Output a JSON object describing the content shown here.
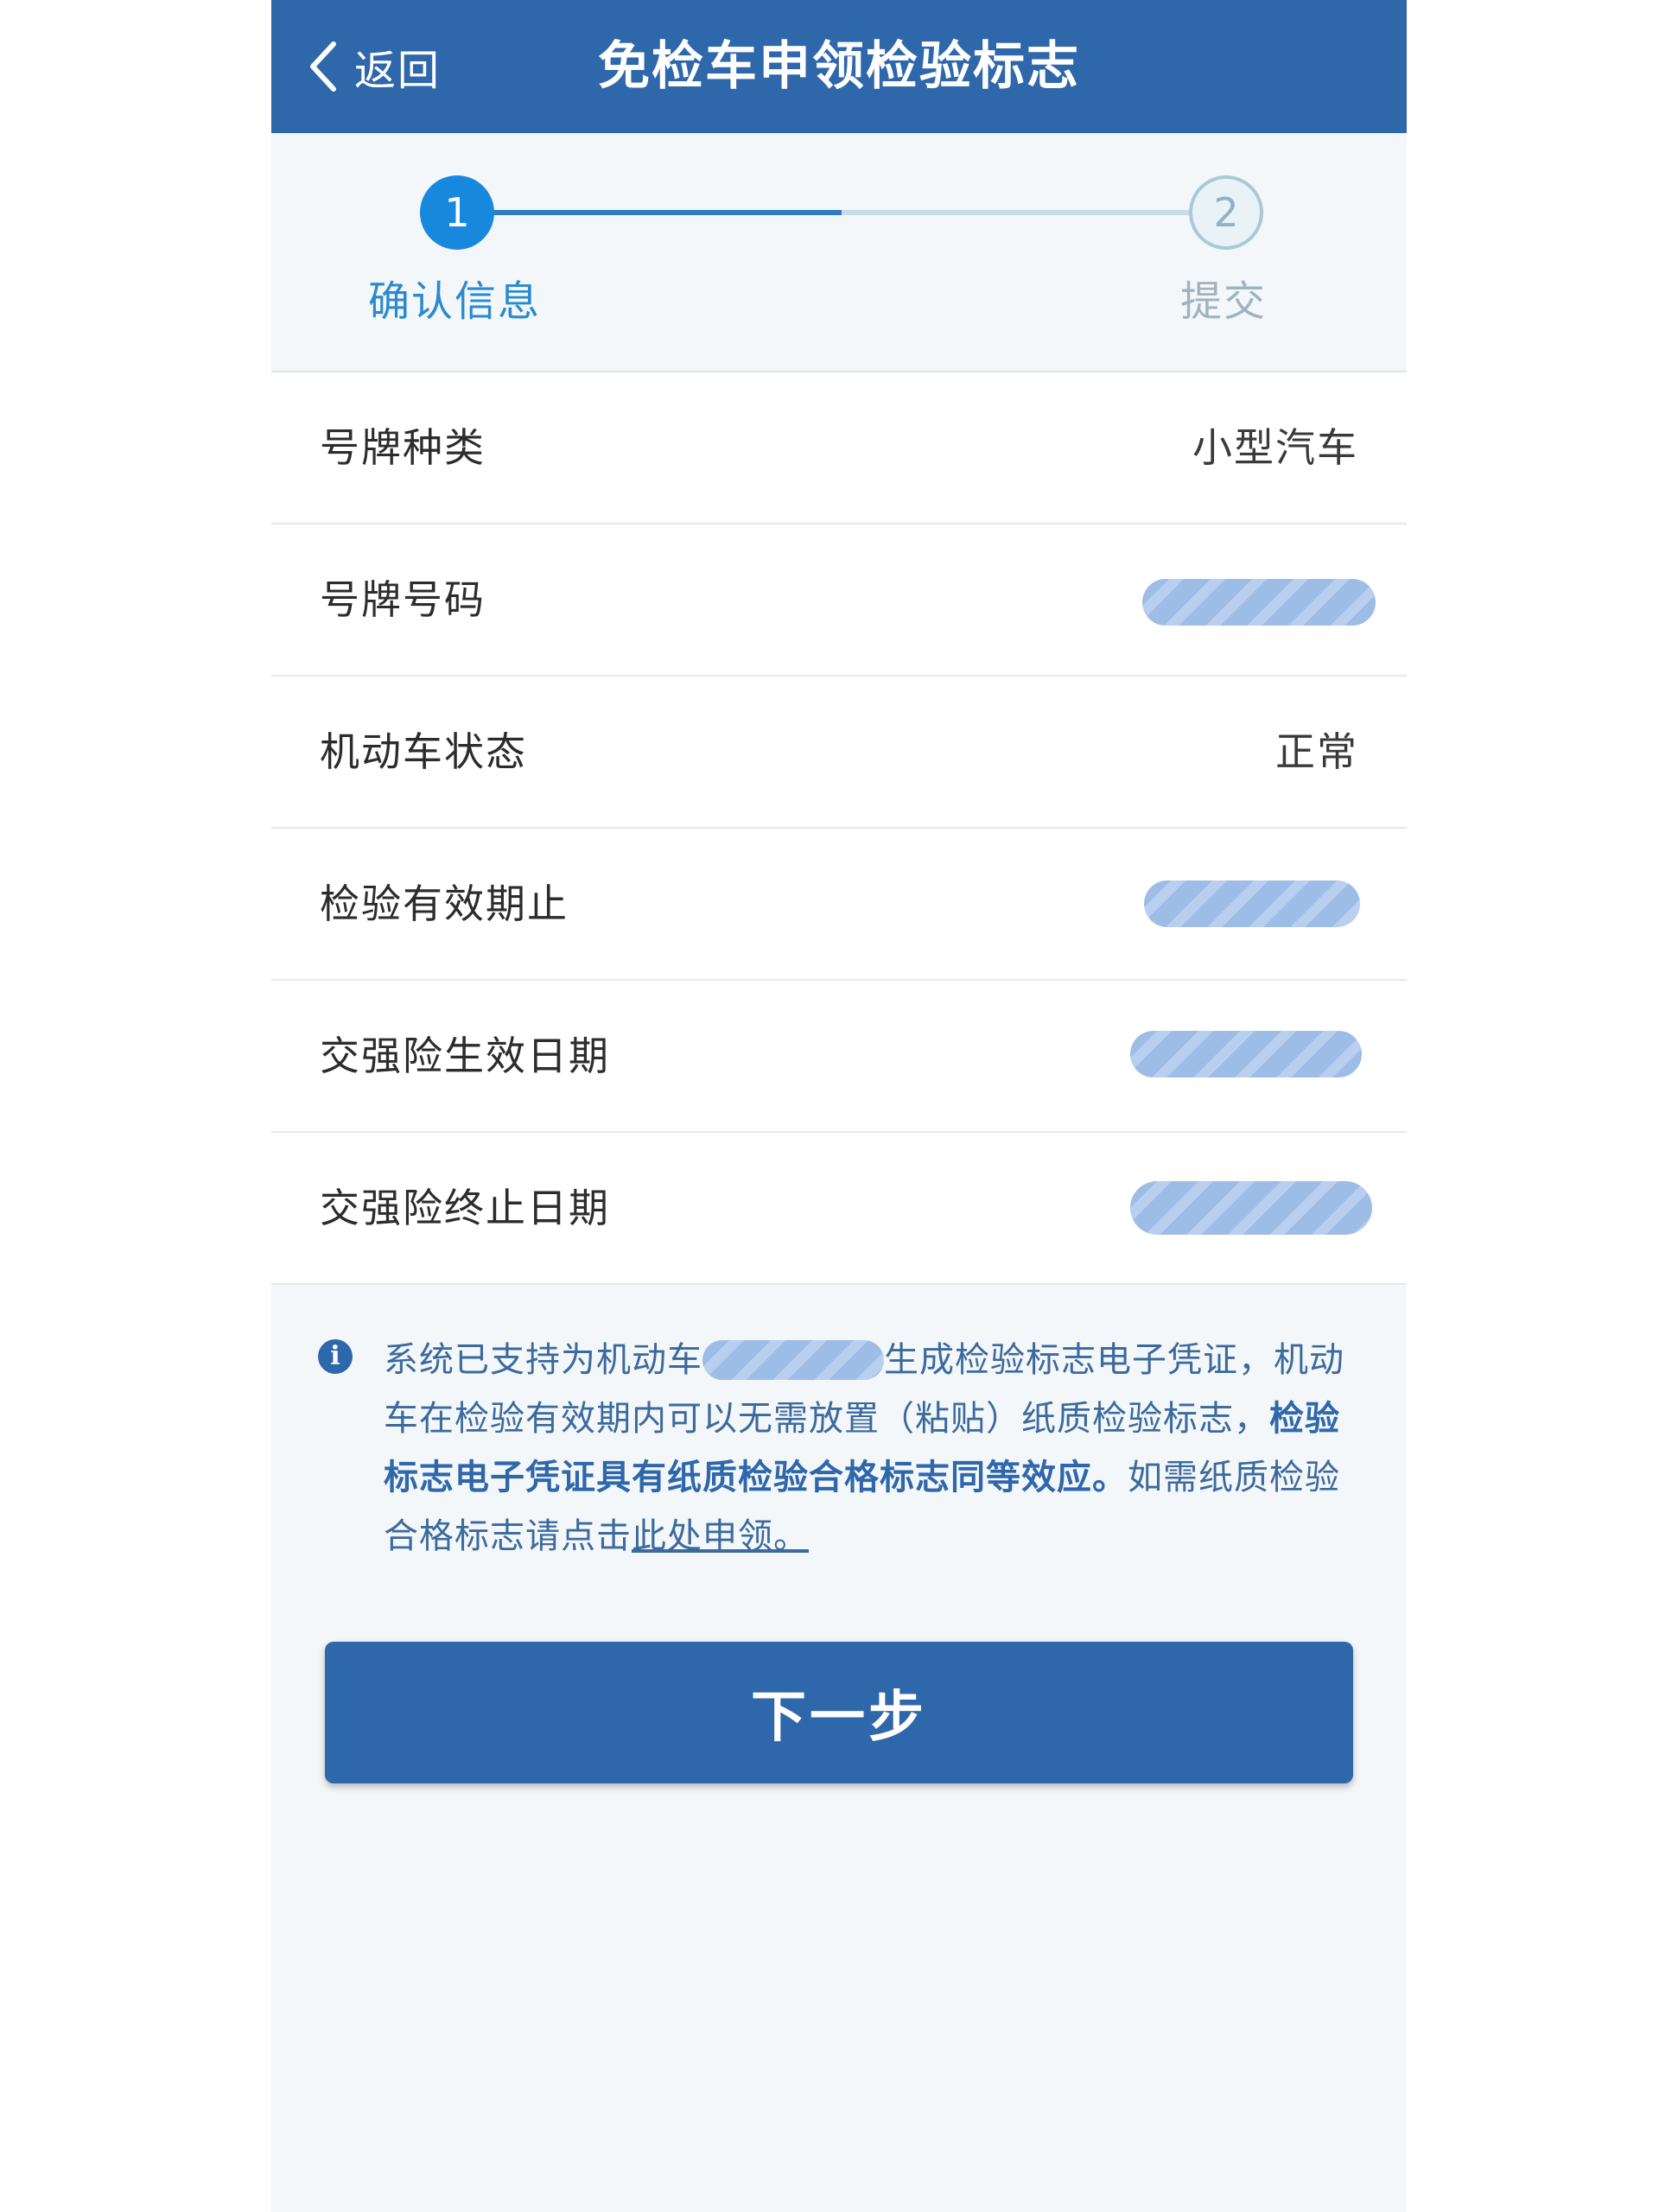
{
  "header": {
    "back_label": "返回",
    "title": "免检车申领检验标志"
  },
  "stepper": {
    "steps": [
      {
        "number": "1",
        "label": "确认信息",
        "state": "active"
      },
      {
        "number": "2",
        "label": "提交",
        "state": "inactive"
      }
    ],
    "progress": 0.5
  },
  "rows": [
    {
      "label": "号牌种类",
      "value": "小型汽车"
    },
    {
      "label": "号牌号码",
      "value": ""
    },
    {
      "label": "机动车状态",
      "value": "正常"
    },
    {
      "label": "检验有效期止",
      "value": ""
    },
    {
      "label": "交强险生效日期",
      "value": ""
    },
    {
      "label": "交强险终止日期",
      "value": ""
    }
  ],
  "notice": {
    "icon": "info-icon",
    "part1": "系统已支持为机动车",
    "part2": "生成检验标志电子凭证，机动车在检验有效期内可以无需放置（粘贴）纸质检验标志，",
    "bold": "检验标志电子凭证具有纸质检验合格标志同等效应。",
    "part3": "如需纸质检验合格标志请点击",
    "link": "此处申领。"
  },
  "next_button": "下一步",
  "colors": {
    "primary": "#2f67ab",
    "step_active": "#1888df",
    "notice_text": "#3b6a9d",
    "background": "#f4f7f9"
  }
}
